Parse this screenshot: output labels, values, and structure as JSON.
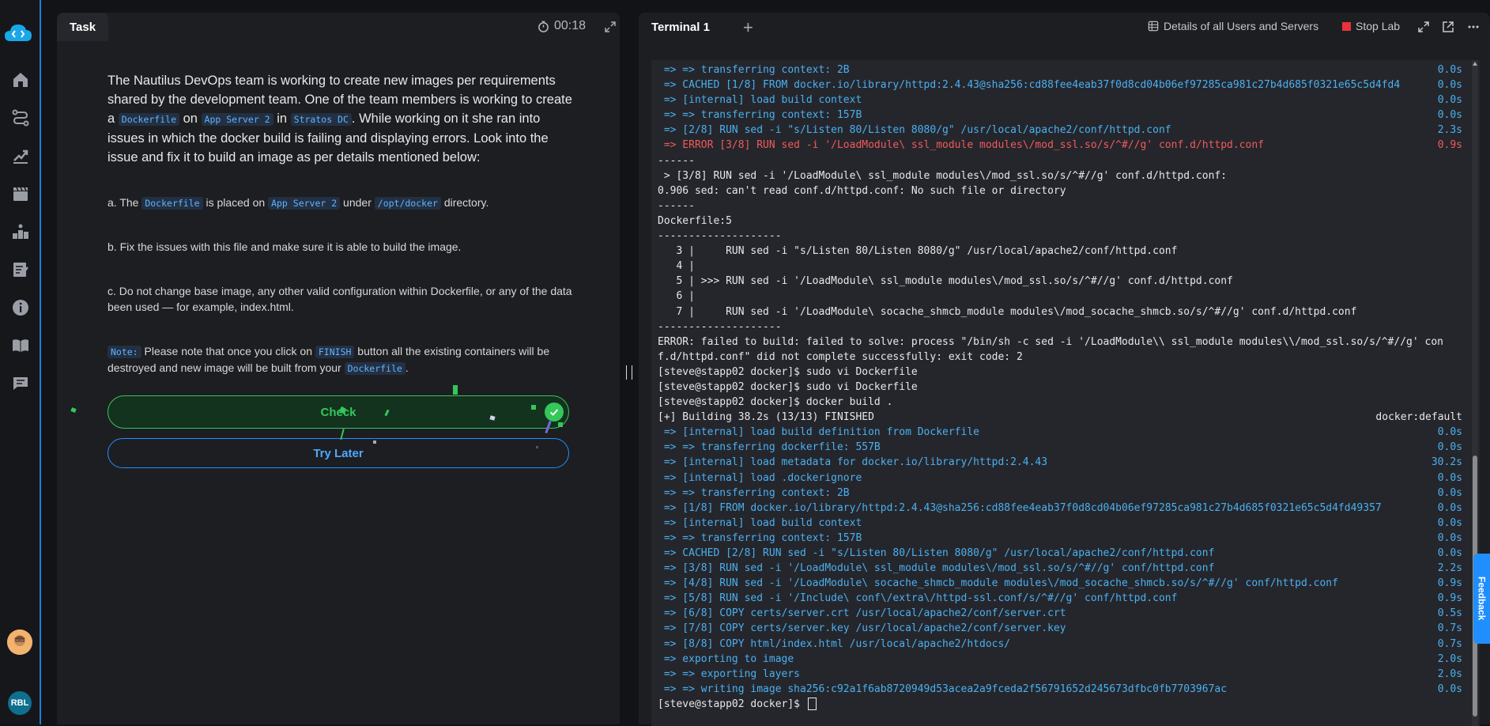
{
  "sidebar": {
    "items": [
      {
        "name": "home-icon"
      },
      {
        "name": "route-icon"
      },
      {
        "name": "progress-chart-icon"
      },
      {
        "name": "clapperboard-icon"
      },
      {
        "name": "leaderboard-icon"
      },
      {
        "name": "assignment-icon"
      },
      {
        "name": "info-icon"
      },
      {
        "name": "book-icon"
      },
      {
        "name": "chat-icon"
      }
    ],
    "user_initials": "RBL"
  },
  "task": {
    "tab_label": "Task",
    "timer": "00:18",
    "intro": {
      "p1": "The Nautilus DevOps team is working to create new images per requirements shared by the development team. One of the team members is working to create a ",
      "c1": "Dockerfile",
      "p2": " on ",
      "c2": "App Server 2",
      "p3": " in ",
      "c3": "Stratos DC",
      "p4": ". While working on it she ran into issues in which the docker build is failing and displaying errors. Look into the issue and fix it to build an image as per details mentioned below:"
    },
    "item_a": {
      "p1": "a. The ",
      "c1": "Dockerfile",
      "p2": " is placed on ",
      "c2": "App Server 2",
      "p3": " under ",
      "c3": "/opt/docker",
      "p4": " directory."
    },
    "item_b": "b. Fix the issues with this file and make sure it is able to build the image.",
    "item_c": "c. Do not change base image, any other valid configuration within Dockerfile, or any of the data been used — for example, index.html.",
    "note": {
      "label": "Note:",
      "p1": " Please note that once you click on ",
      "c1": "FINISH",
      "p2": " button all the existing containers will be destroyed and new image will be built from your ",
      "c2": "Dockerfile",
      "p3": "."
    },
    "check_label": "Check",
    "later_label": "Try Later"
  },
  "terminal": {
    "tab_label": "Terminal 1",
    "details_label": "Details of all Users and Servers",
    "stop_label": "Stop Lab",
    "feedback_label": "Feedback",
    "lines": [
      {
        "text": " => => transferring context: 2B",
        "dur": "0.0s",
        "color": "blue"
      },
      {
        "text": " => CACHED [1/8] FROM docker.io/library/httpd:2.4.43@sha256:cd88fee4eab37f0d8cd04b06ef97285ca981c27b4d685f0321e65c5d4fd4",
        "dur": "0.0s",
        "color": "blue"
      },
      {
        "text": " => [internal] load build context",
        "dur": "0.0s",
        "color": "blue"
      },
      {
        "text": " => => transferring context: 157B",
        "dur": "0.0s",
        "color": "blue"
      },
      {
        "text": " => [2/8] RUN sed -i \"s/Listen 80/Listen 8080/g\" /usr/local/apache2/conf/httpd.conf",
        "dur": "2.3s",
        "color": "blue"
      },
      {
        "text": " => ERROR [3/8] RUN sed -i '/LoadModule\\ ssl_module modules\\/mod_ssl.so/s/^#//g' conf.d/httpd.conf",
        "dur": "0.9s",
        "color": "red"
      },
      {
        "text": "------",
        "dur": "",
        "color": "white"
      },
      {
        "text": " > [3/8] RUN sed -i '/LoadModule\\ ssl_module modules\\/mod_ssl.so/s/^#//g' conf.d/httpd.conf:",
        "dur": "",
        "color": "white"
      },
      {
        "text": "0.906 sed: can't read conf.d/httpd.conf: No such file or directory",
        "dur": "",
        "color": "white"
      },
      {
        "text": "------",
        "dur": "",
        "color": "white"
      },
      {
        "text": "Dockerfile:5",
        "dur": "",
        "color": "white"
      },
      {
        "text": "--------------------",
        "dur": "",
        "color": "white"
      },
      {
        "text": "   3 |     RUN sed -i \"s/Listen 80/Listen 8080/g\" /usr/local/apache2/conf/httpd.conf",
        "dur": "",
        "color": "white"
      },
      {
        "text": "   4 |",
        "dur": "",
        "color": "white"
      },
      {
        "text": "   5 | >>> RUN sed -i '/LoadModule\\ ssl_module modules\\/mod_ssl.so/s/^#//g' conf.d/httpd.conf",
        "dur": "",
        "color": "white"
      },
      {
        "text": "   6 |",
        "dur": "",
        "color": "white"
      },
      {
        "text": "   7 |     RUN sed -i '/LoadModule\\ socache_shmcb_module modules\\/mod_socache_shmcb.so/s/^#//g' conf.d/httpd.conf",
        "dur": "",
        "color": "white"
      },
      {
        "text": "--------------------",
        "dur": "",
        "color": "white"
      },
      {
        "text": "ERROR: failed to build: failed to solve: process \"/bin/sh -c sed -i '/LoadModule\\\\ ssl_module modules\\\\/mod_ssl.so/s/^#//g' con",
        "dur": "",
        "color": "white"
      },
      {
        "text": "f.d/httpd.conf\" did not complete successfully: exit code: 2",
        "dur": "",
        "color": "white"
      },
      {
        "text": "[steve@stapp02 docker]$ sudo vi Dockerfile",
        "dur": "",
        "color": "white"
      },
      {
        "text": "[steve@stapp02 docker]$ sudo vi Dockerfile",
        "dur": "",
        "color": "white"
      },
      {
        "text": "[steve@stapp02 docker]$ docker build .",
        "dur": "",
        "color": "white"
      },
      {
        "text": "[+] Building 38.2s (13/13) FINISHED",
        "dur": "docker:default",
        "color": "white"
      },
      {
        "text": " => [internal] load build definition from Dockerfile",
        "dur": "0.0s",
        "color": "blue"
      },
      {
        "text": " => => transferring dockerfile: 557B",
        "dur": "0.0s",
        "color": "blue"
      },
      {
        "text": " => [internal] load metadata for docker.io/library/httpd:2.4.43",
        "dur": "30.2s",
        "color": "blue"
      },
      {
        "text": " => [internal] load .dockerignore",
        "dur": "0.0s",
        "color": "blue"
      },
      {
        "text": " => => transferring context: 2B",
        "dur": "0.0s",
        "color": "blue"
      },
      {
        "text": " => [1/8] FROM docker.io/library/httpd:2.4.43@sha256:cd88fee4eab37f0d8cd04b06ef97285ca981c27b4d685f0321e65c5d4fd49357",
        "dur": "0.0s",
        "color": "blue"
      },
      {
        "text": " => [internal] load build context",
        "dur": "0.0s",
        "color": "blue"
      },
      {
        "text": " => => transferring context: 157B",
        "dur": "0.0s",
        "color": "blue"
      },
      {
        "text": " => CACHED [2/8] RUN sed -i \"s/Listen 80/Listen 8080/g\" /usr/local/apache2/conf/httpd.conf",
        "dur": "0.0s",
        "color": "blue"
      },
      {
        "text": " => [3/8] RUN sed -i '/LoadModule\\ ssl_module modules\\/mod_ssl.so/s/^#//g' conf/httpd.conf",
        "dur": "2.2s",
        "color": "blue"
      },
      {
        "text": " => [4/8] RUN sed -i '/LoadModule\\ socache_shmcb_module modules\\/mod_socache_shmcb.so/s/^#//g' conf/httpd.conf",
        "dur": "0.9s",
        "color": "blue"
      },
      {
        "text": " => [5/8] RUN sed -i '/Include\\ conf\\/extra\\/httpd-ssl.conf/s/^#//g' conf/httpd.conf",
        "dur": "0.9s",
        "color": "blue"
      },
      {
        "text": " => [6/8] COPY certs/server.crt /usr/local/apache2/conf/server.crt",
        "dur": "0.5s",
        "color": "blue"
      },
      {
        "text": " => [7/8] COPY certs/server.key /usr/local/apache2/conf/server.key",
        "dur": "0.7s",
        "color": "blue"
      },
      {
        "text": " => [8/8] COPY html/index.html /usr/local/apache2/htdocs/",
        "dur": "0.7s",
        "color": "blue"
      },
      {
        "text": " => exporting to image",
        "dur": "2.0s",
        "color": "blue"
      },
      {
        "text": " => => exporting layers",
        "dur": "2.0s",
        "color": "blue"
      },
      {
        "text": " => => writing image sha256:c92a1f6ab8720949d53acea2a9fceda2f56791652d245673dfbc0fb7703967ac",
        "dur": "0.0s",
        "color": "blue"
      },
      {
        "text": "[steve@stapp02 docker]$ ",
        "dur": "",
        "color": "white",
        "cursor": true
      }
    ]
  }
}
